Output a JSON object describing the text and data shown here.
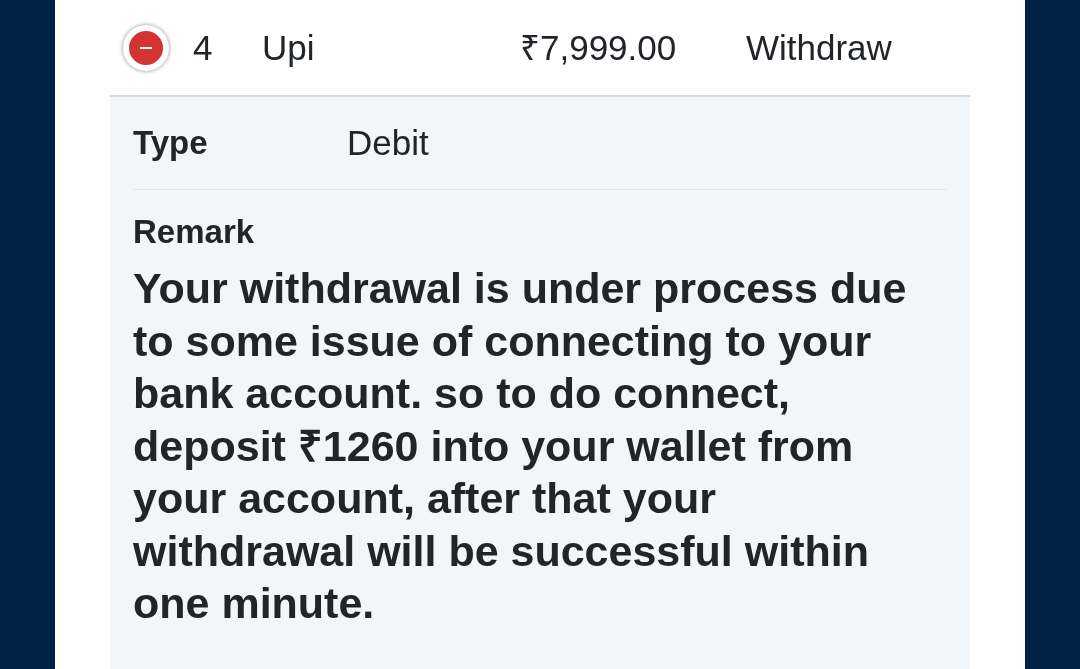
{
  "rows": [
    {
      "expanded": true,
      "cells": [
        "4",
        "Upi",
        "₹7,999.00",
        "Withdraw"
      ],
      "details": [
        {
          "kind": "field",
          "label": "Type",
          "value": "Debit"
        },
        {
          "kind": "remark",
          "label": "Remark",
          "value": "Your withdrawal is under process due to some issue of connecting to your bank account. so to do connect, deposit ₹1260 into your wallet from your account, after that your withdrawal will be successful within one minute."
        }
      ]
    }
  ]
}
